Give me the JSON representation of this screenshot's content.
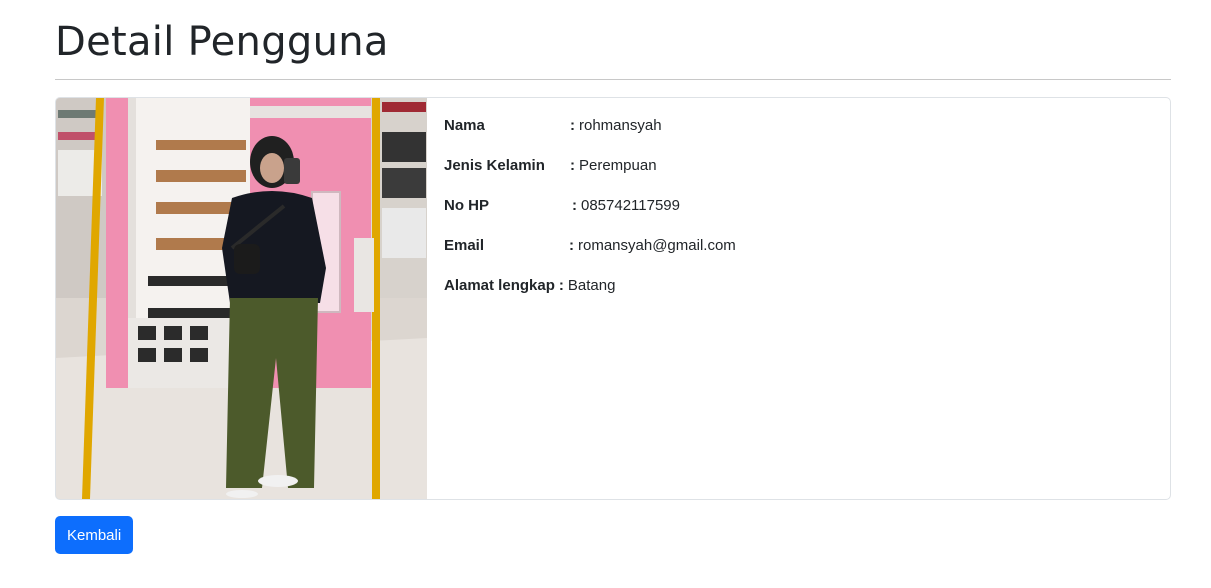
{
  "page": {
    "title": "Detail Pengguna"
  },
  "profile": {
    "photo_alt": "Foto pengguna",
    "fields": [
      {
        "label": "Nama",
        "sep": ":",
        "value": "rohmansyah"
      },
      {
        "label": "Jenis Kelamin",
        "sep": ":",
        "value": "Perempuan"
      },
      {
        "label": "No HP",
        "sep": ":",
        "value": "085742117599"
      },
      {
        "label": "Email",
        "sep": ":",
        "value": "romansyah@gmail.com"
      },
      {
        "label": "Alamat lengkap",
        "sep": ":",
        "value": "Batang"
      }
    ]
  },
  "actions": {
    "back_label": "Kembali"
  },
  "colors": {
    "primary": "#0d6efd",
    "text": "#212529",
    "border": "#dee2e6",
    "wall_pink": "#f08fb1",
    "frame_gold": "#e0a700",
    "pants_olive": "#4c5a2b"
  }
}
